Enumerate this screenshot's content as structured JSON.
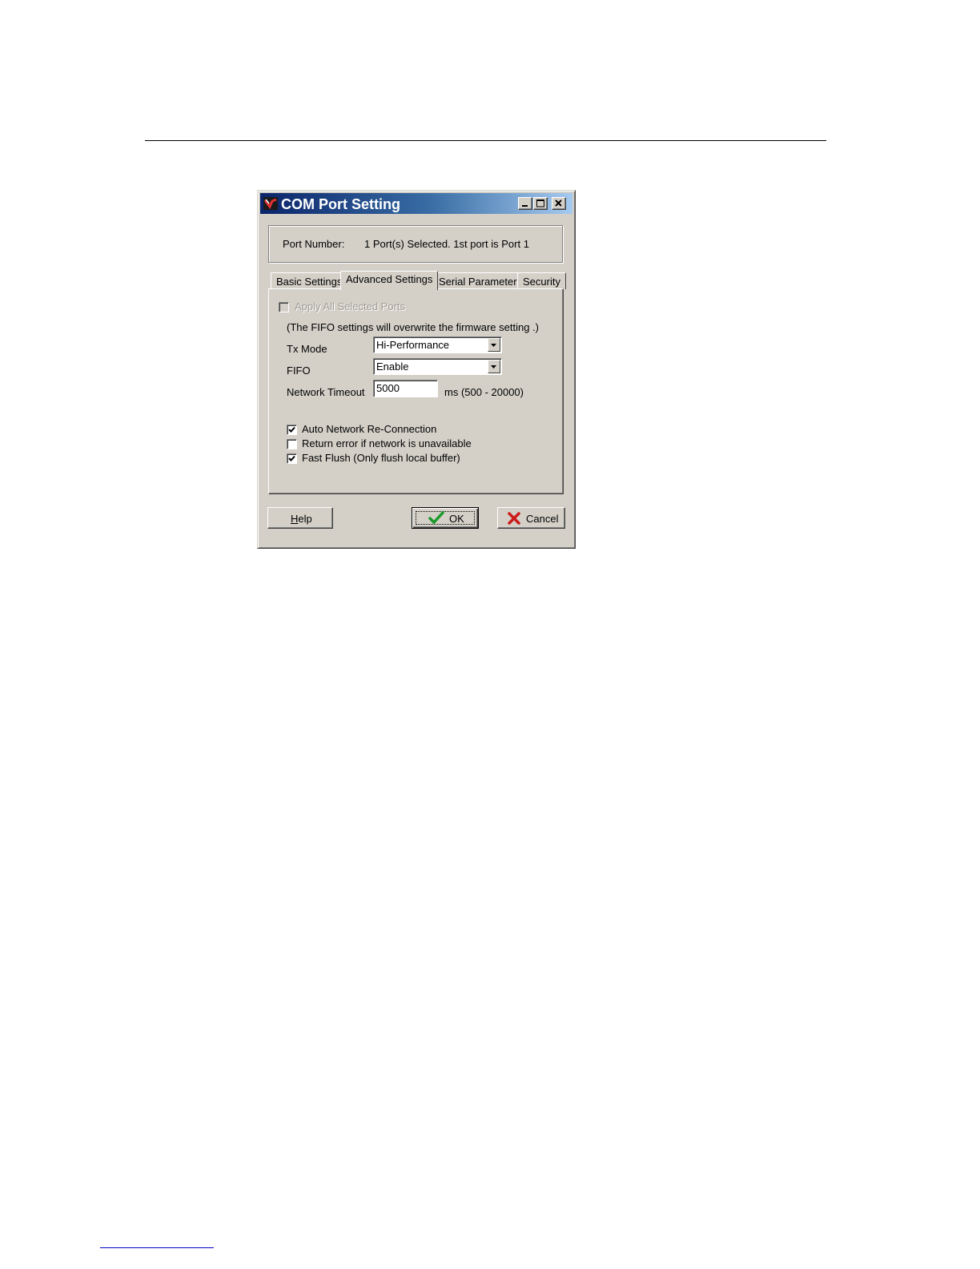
{
  "window": {
    "title": "COM Port Setting"
  },
  "port": {
    "label": "Port Number:",
    "value": "1 Port(s) Selected. 1st port is Port 1"
  },
  "tabs": [
    {
      "label": "Basic Settings",
      "active": false
    },
    {
      "label": "Advanced Settings",
      "active": true
    },
    {
      "label": "Serial Parameters",
      "active": false
    },
    {
      "label": "Security",
      "active": false
    }
  ],
  "advanced": {
    "apply_all": {
      "label": "Apply All Selected Ports",
      "checked": false,
      "enabled": false
    },
    "fifo_note": "(The FIFO settings will overwrite the firmware setting .)",
    "tx_mode": {
      "label": "Tx Mode",
      "value": "Hi-Performance"
    },
    "fifo": {
      "label": "FIFO",
      "value": "Enable"
    },
    "network_timeout": {
      "label": "Network Timeout",
      "value": "5000",
      "unit": "ms (500 - 20000)"
    },
    "options": [
      {
        "label": "Auto Network Re-Connection",
        "checked": true
      },
      {
        "label": "Return error if network is unavailable",
        "checked": false
      },
      {
        "label": "Fast Flush (Only flush local buffer)",
        "checked": true
      }
    ]
  },
  "buttons": {
    "help": {
      "hotkey": "H",
      "rest": "elp"
    },
    "ok": "OK",
    "cancel": "Cancel"
  }
}
